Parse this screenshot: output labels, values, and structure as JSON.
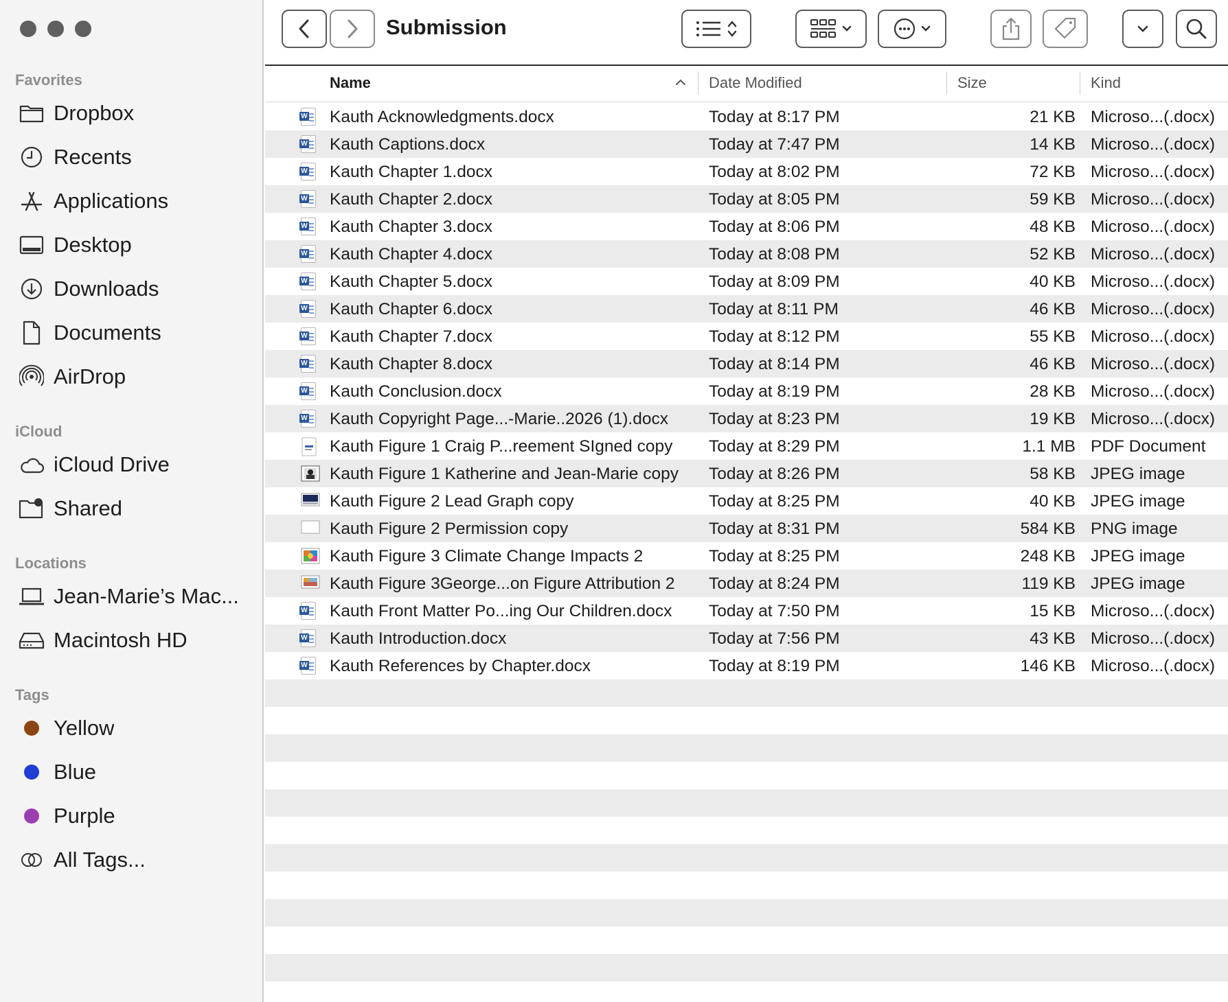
{
  "window": {
    "title": "Submission"
  },
  "sidebar": {
    "favorites_title": "Favorites",
    "favorites": [
      {
        "label": "Dropbox",
        "icon": "folder-icon"
      },
      {
        "label": "Recents",
        "icon": "clock-icon"
      },
      {
        "label": "Applications",
        "icon": "applications-icon"
      },
      {
        "label": "Desktop",
        "icon": "desktop-icon"
      },
      {
        "label": "Downloads",
        "icon": "download-icon"
      },
      {
        "label": "Documents",
        "icon": "document-icon"
      },
      {
        "label": "AirDrop",
        "icon": "airdrop-icon"
      }
    ],
    "icloud_title": "iCloud",
    "icloud": [
      {
        "label": "iCloud Drive",
        "icon": "cloud-icon"
      },
      {
        "label": "Shared",
        "icon": "shared-folder-icon"
      }
    ],
    "locations_title": "Locations",
    "locations": [
      {
        "label": "Jean-Marie’s Mac...",
        "icon": "laptop-icon"
      },
      {
        "label": "Macintosh HD",
        "icon": "drive-icon"
      }
    ],
    "tags_title": "Tags",
    "tags": [
      {
        "label": "Yellow",
        "color": "#8B4513"
      },
      {
        "label": "Blue",
        "color": "#1f3fd6"
      },
      {
        "label": "Purple",
        "color": "#9b3fb0"
      },
      {
        "label": "All Tags...",
        "color": ""
      }
    ]
  },
  "columns": {
    "name": "Name",
    "date": "Date Modified",
    "size": "Size",
    "kind": "Kind"
  },
  "files": [
    {
      "name": "Kauth Acknowledgments.docx",
      "date": "Today at 8:17 PM",
      "size": "21 KB",
      "kind": "Microso...(.docx)",
      "type": "word"
    },
    {
      "name": "Kauth Captions.docx",
      "date": "Today at 7:47 PM",
      "size": "14 KB",
      "kind": "Microso...(.docx)",
      "type": "word"
    },
    {
      "name": "Kauth Chapter 1.docx",
      "date": "Today at 8:02 PM",
      "size": "72 KB",
      "kind": "Microso...(.docx)",
      "type": "word"
    },
    {
      "name": "Kauth Chapter 2.docx",
      "date": "Today at 8:05 PM",
      "size": "59 KB",
      "kind": "Microso...(.docx)",
      "type": "word"
    },
    {
      "name": "Kauth Chapter 3.docx",
      "date": "Today at 8:06 PM",
      "size": "48 KB",
      "kind": "Microso...(.docx)",
      "type": "word"
    },
    {
      "name": "Kauth Chapter 4.docx",
      "date": "Today at 8:08 PM",
      "size": "52 KB",
      "kind": "Microso...(.docx)",
      "type": "word"
    },
    {
      "name": "Kauth Chapter 5.docx",
      "date": "Today at 8:09 PM",
      "size": "40 KB",
      "kind": "Microso...(.docx)",
      "type": "word"
    },
    {
      "name": "Kauth Chapter 6.docx",
      "date": "Today at 8:11 PM",
      "size": "46 KB",
      "kind": "Microso...(.docx)",
      "type": "word"
    },
    {
      "name": "Kauth Chapter 7.docx",
      "date": "Today at 8:12 PM",
      "size": "55 KB",
      "kind": "Microso...(.docx)",
      "type": "word"
    },
    {
      "name": "Kauth Chapter 8.docx",
      "date": "Today at 8:14 PM",
      "size": "46 KB",
      "kind": "Microso...(.docx)",
      "type": "word"
    },
    {
      "name": "Kauth Conclusion.docx",
      "date": "Today at 8:19 PM",
      "size": "28 KB",
      "kind": "Microso...(.docx)",
      "type": "word"
    },
    {
      "name": "Kauth Copyright Page...-Marie..2026 (1).docx",
      "date": "Today at 8:23 PM",
      "size": "19 KB",
      "kind": "Microso...(.docx)",
      "type": "word"
    },
    {
      "name": "Kauth Figure 1 Craig P...reement SIgned copy",
      "date": "Today at 8:29 PM",
      "size": "1.1 MB",
      "kind": "PDF Document",
      "type": "pdf"
    },
    {
      "name": "Kauth Figure 1 Katherine and Jean-Marie copy",
      "date": "Today at 8:26 PM",
      "size": "58 KB",
      "kind": "JPEG image",
      "type": "photo"
    },
    {
      "name": "Kauth Figure 2 Lead Graph copy",
      "date": "Today at 8:25 PM",
      "size": "40 KB",
      "kind": "JPEG image",
      "type": "graph"
    },
    {
      "name": "Kauth Figure 2 Permission copy",
      "date": "Today at 8:31 PM",
      "size": "584 KB",
      "kind": "PNG image",
      "type": "png"
    },
    {
      "name": "Kauth Figure 3 Climate Change Impacts 2",
      "date": "Today at 8:25 PM",
      "size": "248 KB",
      "kind": "JPEG image",
      "type": "colorful"
    },
    {
      "name": "Kauth Figure 3George...on Figure Attribution 2",
      "date": "Today at 8:24 PM",
      "size": "119 KB",
      "kind": "JPEG image",
      "type": "colorful2"
    },
    {
      "name": "Kauth Front Matter Po...ing Our Children.docx",
      "date": "Today at 7:50 PM",
      "size": "15 KB",
      "kind": "Microso...(.docx)",
      "type": "word"
    },
    {
      "name": "Kauth Introduction.docx",
      "date": "Today at 7:56 PM",
      "size": "43 KB",
      "kind": "Microso...(.docx)",
      "type": "word"
    },
    {
      "name": "Kauth References by Chapter.docx",
      "date": "Today at 8:19 PM",
      "size": "146 KB",
      "kind": "Microso...(.docx)",
      "type": "word"
    }
  ],
  "toolbar": {
    "buttons": [
      "back-button",
      "forward-button",
      "list-view-button",
      "group-button",
      "more-actions-button",
      "share-button",
      "tag-button",
      "expand-button",
      "search-button"
    ]
  }
}
